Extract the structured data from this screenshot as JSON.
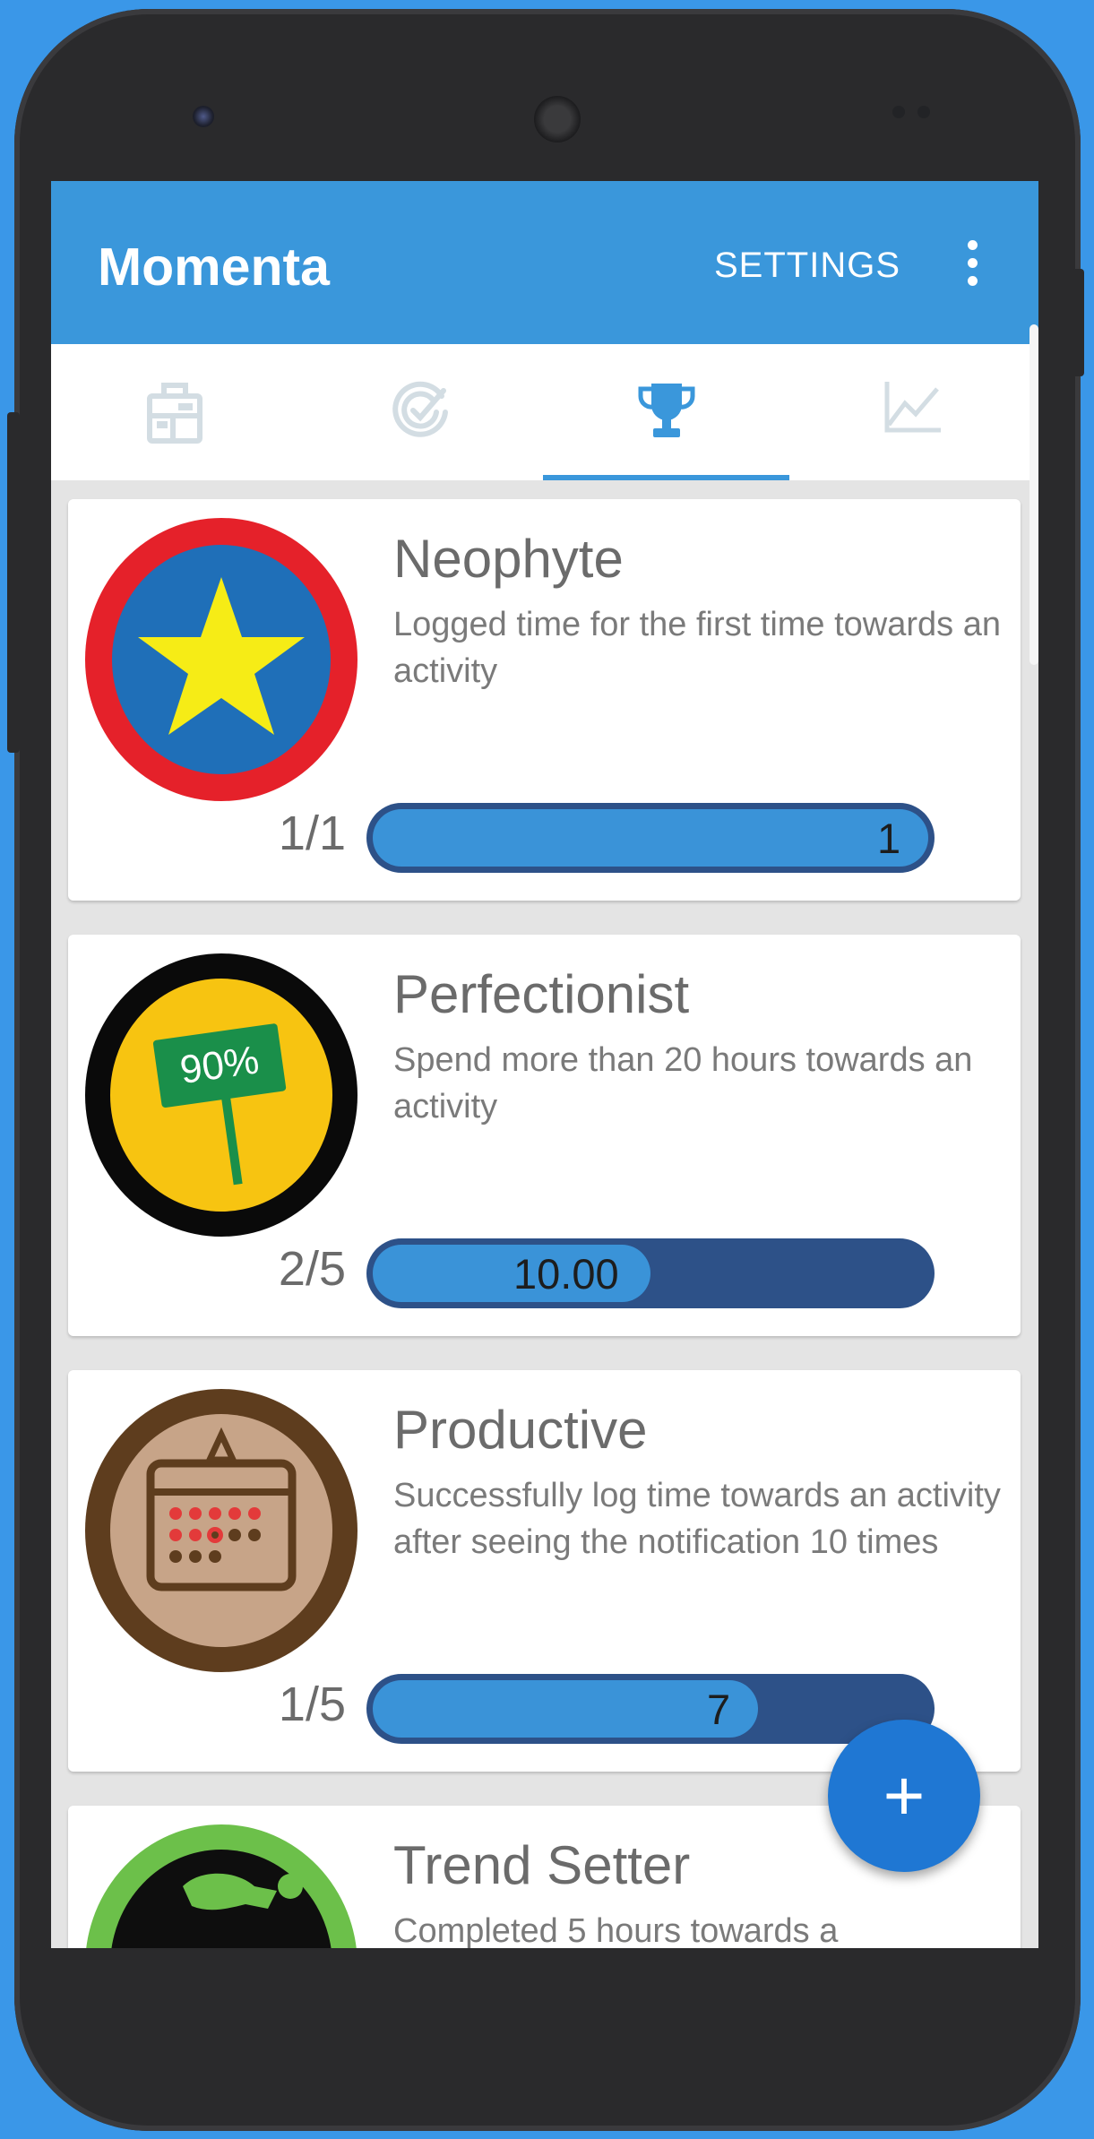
{
  "app": {
    "title": "Momenta",
    "settings_label": "SETTINGS",
    "accent_color": "#3a97db"
  },
  "tabs": [
    {
      "icon": "dashboard-icon",
      "selected": false
    },
    {
      "icon": "goal-check-icon",
      "selected": false
    },
    {
      "icon": "trophy-icon",
      "selected": true
    },
    {
      "icon": "chart-icon",
      "selected": false
    }
  ],
  "achievements": [
    {
      "title": "Neophyte",
      "description": "Logged time for the first time towards an activity",
      "count": "1/1",
      "progress_value": "1",
      "progress_fraction": 1.0,
      "badge_icon": "star-badge-icon"
    },
    {
      "title": "Perfectionist",
      "description": "Spend more than 20 hours towards an activity",
      "count": "2/5",
      "progress_value": "10.00",
      "progress_fraction": 0.5,
      "badge_icon": "sign-badge-icon",
      "badge_text": "90%"
    },
    {
      "title": "Productive",
      "description": "Successfully log time towards an activity after seeing the notification 10 times",
      "count": "1/5",
      "progress_value": "7",
      "progress_fraction": 0.7,
      "badge_icon": "calendar-badge-icon"
    },
    {
      "title": "Trend Setter",
      "description": "Completed 5 hours towards a",
      "badge_icon": "runner-badge-icon"
    }
  ],
  "fab": {
    "label": "+",
    "icon": "plus-icon"
  }
}
